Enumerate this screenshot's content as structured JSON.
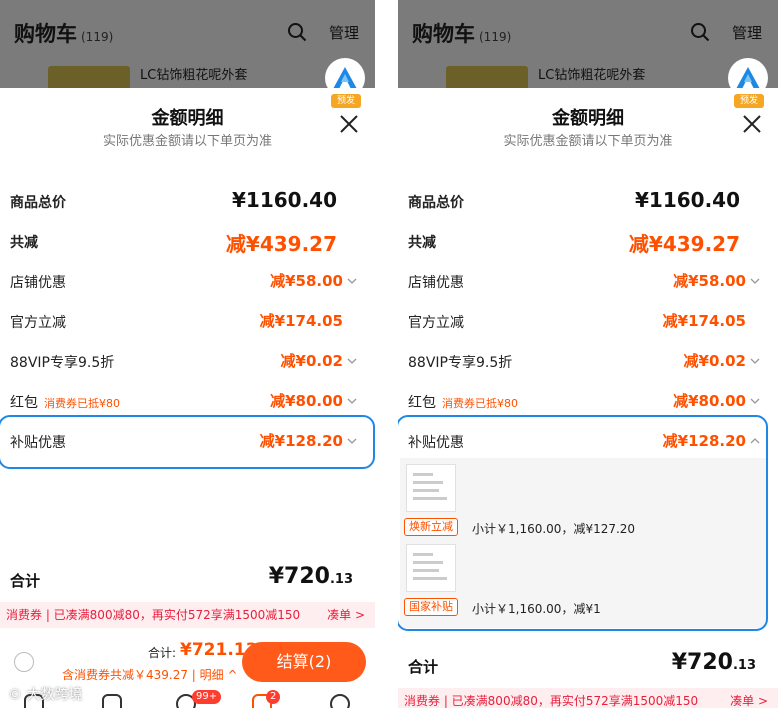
{
  "cart": {
    "title": "购物车",
    "count": "(119)",
    "manage": "管理"
  },
  "product": {
    "name": "LC钻饰粗花呢外套"
  },
  "logo": {
    "tag": "预发"
  },
  "sheet": {
    "title": "金额明细",
    "subtitle": "实际优惠金额请以下单页为准"
  },
  "rows": [
    {
      "label": "商品总价",
      "value": "¥1160.40"
    },
    {
      "label": "共减",
      "value": "减¥439.27"
    },
    {
      "label": "店铺优惠",
      "value": "减¥58.00"
    },
    {
      "label": "官方立减",
      "value": "减¥174.05"
    },
    {
      "label": "88VIP专享9.5折",
      "value": "减¥0.02"
    },
    {
      "label": "红包",
      "note": "消费券已抵¥80",
      "value": "减¥80.00"
    },
    {
      "label": "补贴优惠",
      "value": "减¥128.20"
    }
  ],
  "subsidies": [
    {
      "tag": "焕新立减",
      "text": "小计￥1,160.00，减¥127.20"
    },
    {
      "tag": "国家补贴",
      "text": "小计￥1,160.00，减¥1"
    }
  ],
  "total": {
    "label": "合计",
    "value": "¥720",
    "decimals": ".13"
  },
  "promo": {
    "text": "消费券 | 已凑满800减80，再实付572享满1500减150",
    "more": "凑单 >"
  },
  "bottom": {
    "sum_label": "合计:",
    "sum_value": "¥721.13",
    "sum_note": "含消费券共减￥439.27 | 明细 ^",
    "pay_label": "结算(2)"
  },
  "tabbar": {
    "msg_badge": "99+",
    "cart_badge": "2"
  },
  "watermark": "© 大数跨境",
  "colors": {
    "accent": "#ff5000",
    "highlight": "#1e88e5",
    "pay": "#ff5a1a",
    "promo_bg": "#ffeef0"
  }
}
